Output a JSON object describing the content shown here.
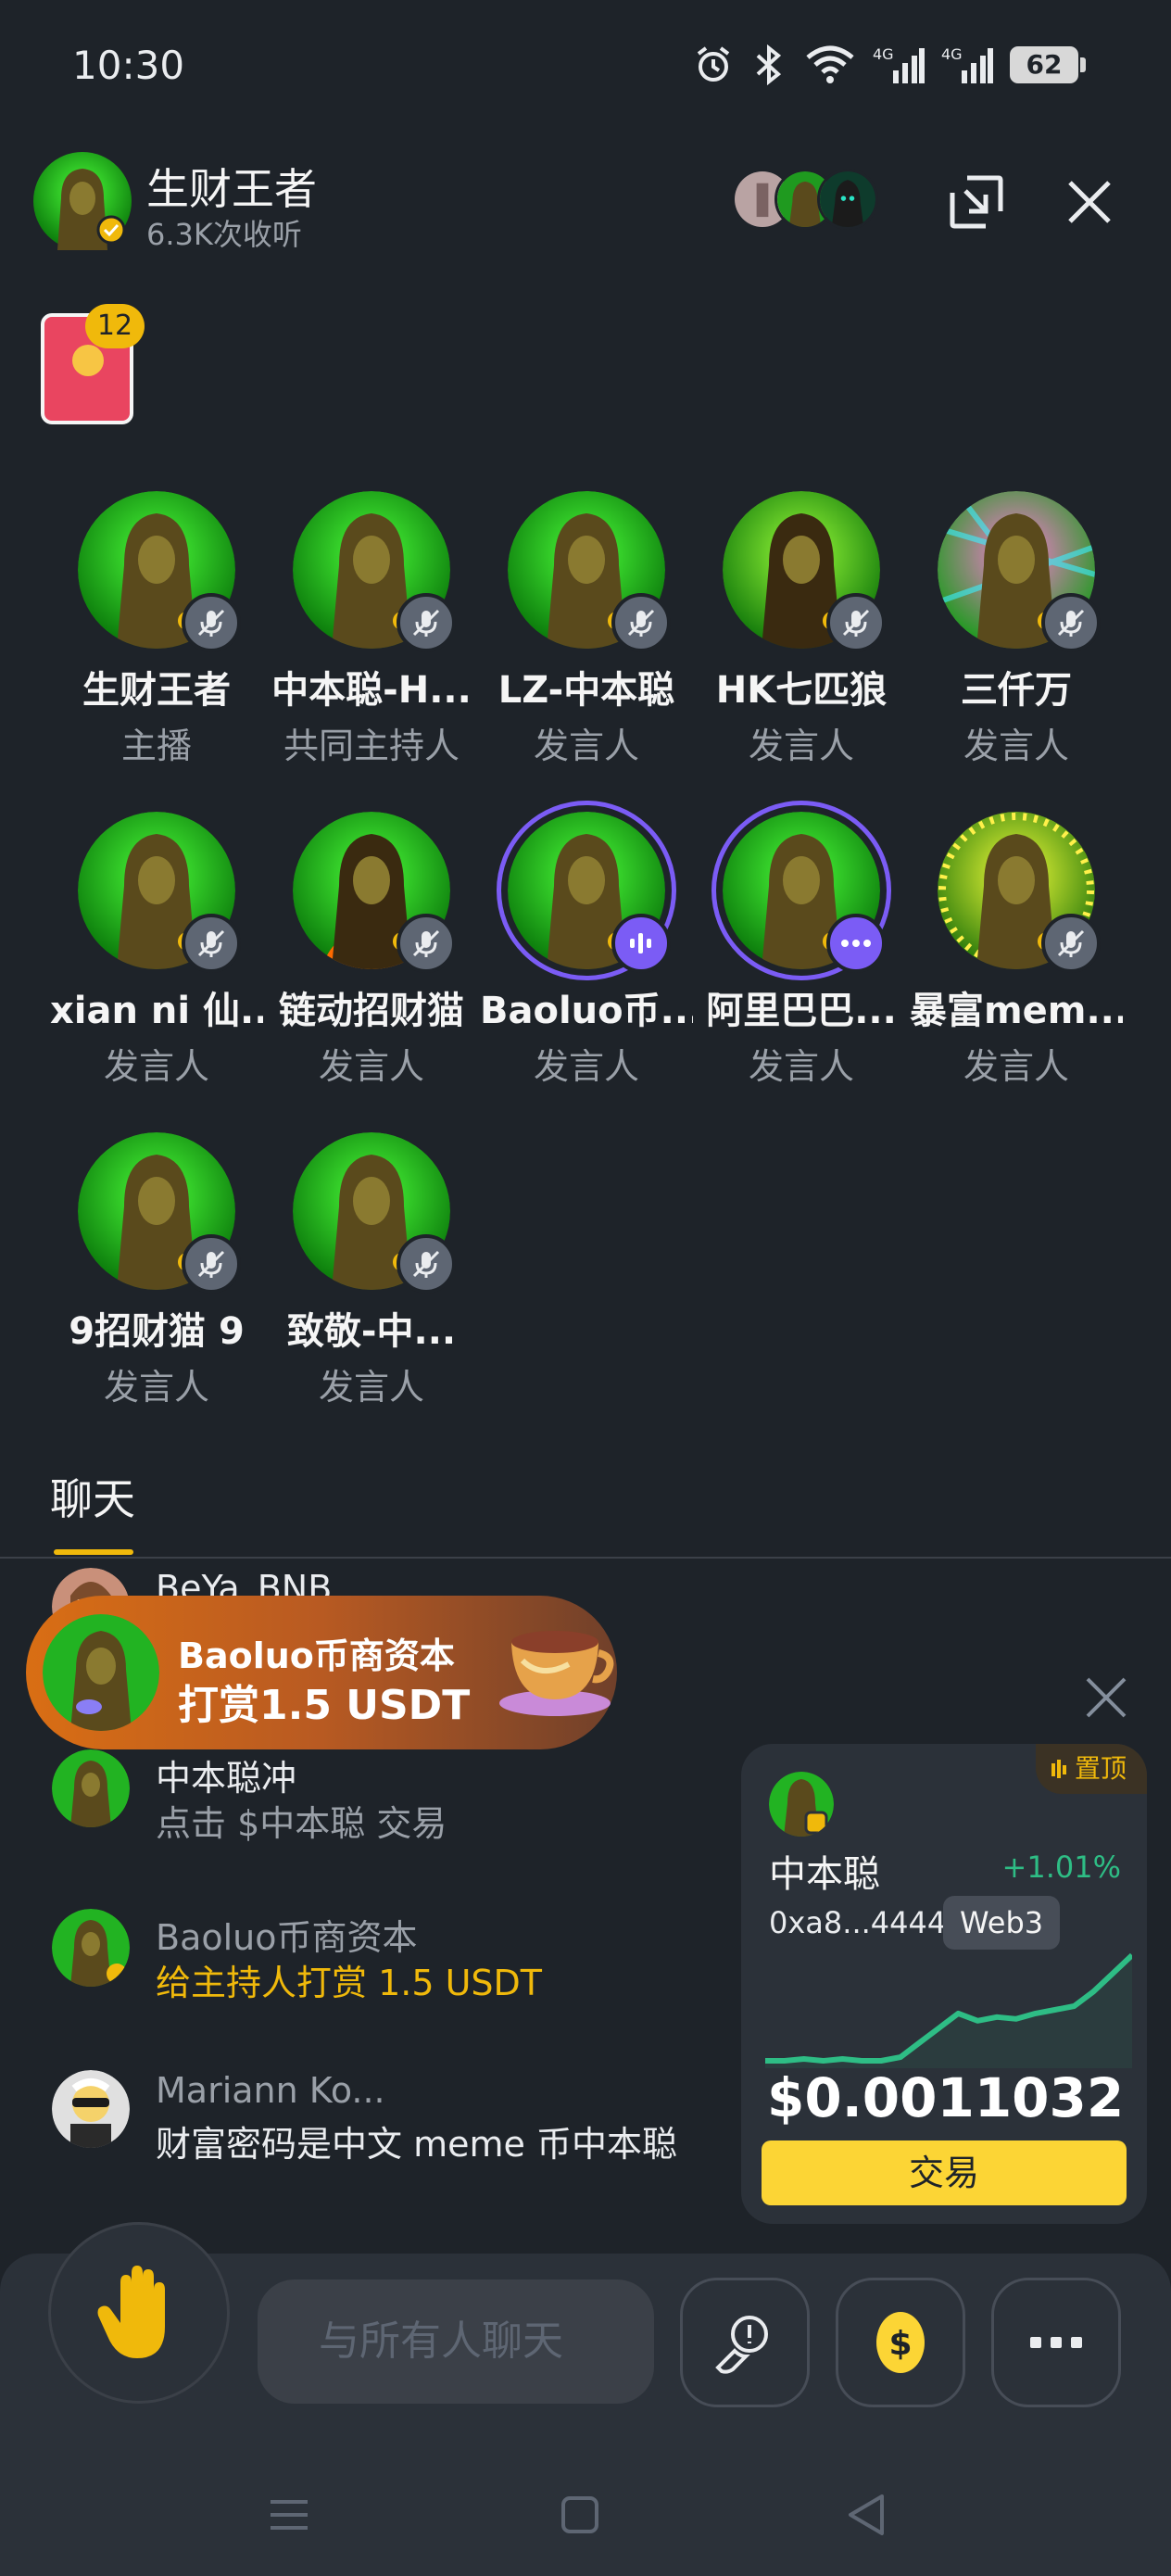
{
  "status_bar": {
    "time": "10:30",
    "battery": "62",
    "icons": [
      "alarm-icon",
      "bluetooth-icon",
      "wifi-icon",
      "signal-4g-icon",
      "signal-4g-icon",
      "battery-icon"
    ]
  },
  "room": {
    "title": "生财王者",
    "listens": "6.3K次收听",
    "red_packet_count": "12"
  },
  "speakers": [
    {
      "name": "生财王者",
      "role": "主播",
      "mic": "muted",
      "avatar": "green"
    },
    {
      "name": "中本聪-H...",
      "role": "共同主持人",
      "mic": "muted",
      "avatar": "green"
    },
    {
      "name": "LZ-中本聪",
      "role": "发言人",
      "mic": "muted",
      "avatar": "green"
    },
    {
      "name": "HK七匹狼",
      "role": "发言人",
      "mic": "muted",
      "avatar": "gold"
    },
    {
      "name": "三仟万",
      "role": "发言人",
      "mic": "muted",
      "avatar": "rainbow"
    },
    {
      "name": "xian ni 仙...",
      "role": "发言人",
      "mic": "muted",
      "avatar": "green"
    },
    {
      "name": "链动招财猫",
      "role": "发言人",
      "mic": "muted",
      "avatar": "fire"
    },
    {
      "name": "Baoluo币...",
      "role": "发言人",
      "mic": "speaking",
      "avatar": "green"
    },
    {
      "name": "阿里巴巴...",
      "role": "发言人",
      "mic": "more",
      "avatar": "green"
    },
    {
      "name": "暴富mem...",
      "role": "发言人",
      "mic": "muted",
      "avatar": "yellow"
    },
    {
      "name": "9招财猫 9",
      "role": "发言人",
      "mic": "muted",
      "avatar": "green"
    },
    {
      "name": "致敬-中...",
      "role": "发言人",
      "mic": "muted",
      "avatar": "green"
    }
  ],
  "chat": {
    "tab_label": "聊天",
    "tip_toast": {
      "name": "Baoluo币商资本",
      "amount": "打赏1.5 USDT"
    },
    "messages": [
      {
        "name": "中本聪冲",
        "text": "点击 $中本聪 交易",
        "style": "muted"
      },
      {
        "name": "Baoluo币商资本",
        "text": "给主持人打赏 1.5 USDT",
        "style": "gold"
      },
      {
        "name": "Mariann Ko...",
        "text": "财富密码是中文 meme 币中本聪",
        "style": "normal"
      }
    ],
    "partial_name": "BeYa_BNB"
  },
  "token_card": {
    "pin_label": "置顶",
    "name": "中本聪",
    "change": "+1.01%",
    "address": "0xa8...4444",
    "chip": "Web3",
    "price": "$0.0011032",
    "trade_label": "交易",
    "sparkline": [
      12,
      12,
      13,
      12,
      13,
      12,
      12,
      14,
      22,
      30,
      38,
      34,
      36,
      35,
      38,
      40,
      42,
      50,
      60,
      70
    ],
    "up_color": "#2ebd85"
  },
  "bottom_bar": {
    "chat_placeholder": "与所有人聊天",
    "buttons": [
      "raise-hand-icon",
      "prompt-icon",
      "tip-coin-icon",
      "more-icon"
    ]
  },
  "colors": {
    "background": "#1e2329",
    "accent": "#f0b90b",
    "speaking": "#7b5cf5"
  }
}
